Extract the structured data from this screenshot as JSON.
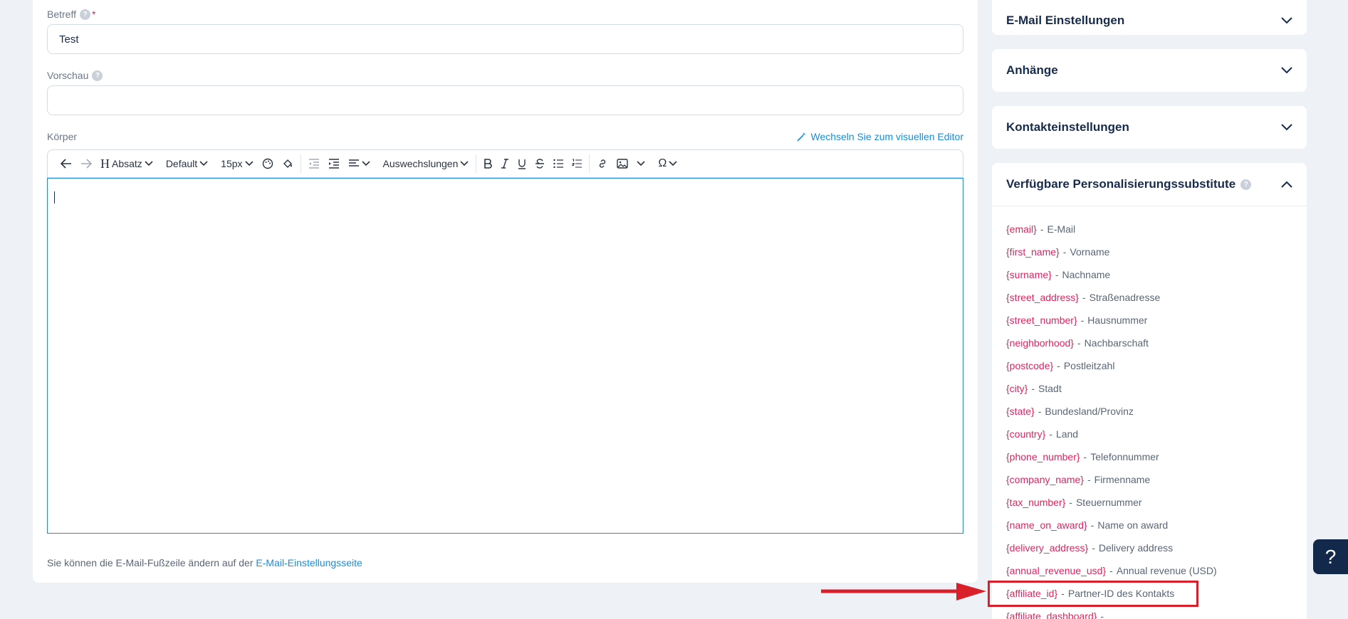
{
  "form": {
    "subject_label": "Betreff",
    "subject_required": "*",
    "subject_value": "Test",
    "preview_label": "Vorschau",
    "preview_value": "",
    "body_label": "Körper",
    "switch_editor_link": "Wechseln Sie zum visuellen Editor",
    "footer_text": "Sie können die E-Mail-Fußzeile ändern auf der",
    "footer_link": "E-Mail-Einstellungsseite"
  },
  "toolbar": {
    "paragraph_label": "Absatz",
    "font_label": "Default",
    "size_label": "15px",
    "replacements_label": "Auswechslungen",
    "heading_glyph": "H",
    "special_char_glyph": "Ω"
  },
  "sidebar": {
    "sections": [
      {
        "title": "E-Mail Einstellungen",
        "expanded": false
      },
      {
        "title": "Anhänge",
        "expanded": false
      },
      {
        "title": "Kontakteinstellungen",
        "expanded": false
      },
      {
        "title": "Verfügbare Personalisierungssubstitute",
        "expanded": true
      }
    ],
    "substitutes": [
      {
        "key": "{email}",
        "desc": "E-Mail"
      },
      {
        "key": "{first_name}",
        "desc": "Vorname"
      },
      {
        "key": "{surname}",
        "desc": "Nachname"
      },
      {
        "key": "{street_address}",
        "desc": "Straßenadresse"
      },
      {
        "key": "{street_number}",
        "desc": "Hausnummer"
      },
      {
        "key": "{neighborhood}",
        "desc": "Nachbarschaft"
      },
      {
        "key": "{postcode}",
        "desc": "Postleitzahl"
      },
      {
        "key": "{city}",
        "desc": "Stadt"
      },
      {
        "key": "{state}",
        "desc": "Bundesland/Provinz"
      },
      {
        "key": "{country}",
        "desc": "Land"
      },
      {
        "key": "{phone_number}",
        "desc": "Telefonnummer"
      },
      {
        "key": "{company_name}",
        "desc": "Firmenname"
      },
      {
        "key": "{tax_number}",
        "desc": "Steuernummer"
      },
      {
        "key": "{name_on_award}",
        "desc": "Name on award"
      },
      {
        "key": "{delivery_address}",
        "desc": "Delivery address"
      },
      {
        "key": "{annual_revenue_usd}",
        "desc": "Annual revenue (USD)"
      },
      {
        "key": "{affiliate_id}",
        "desc": "Partner-ID des Kontakts"
      },
      {
        "key": "{affiliate_dashboard}",
        "desc": ""
      }
    ],
    "separator": "-"
  },
  "help": {
    "label": "?"
  },
  "colors": {
    "accent": "#1a8cd8",
    "substitute_key": "#e0245e",
    "highlight": "#d81f2a",
    "help_bg": "#13294b"
  }
}
